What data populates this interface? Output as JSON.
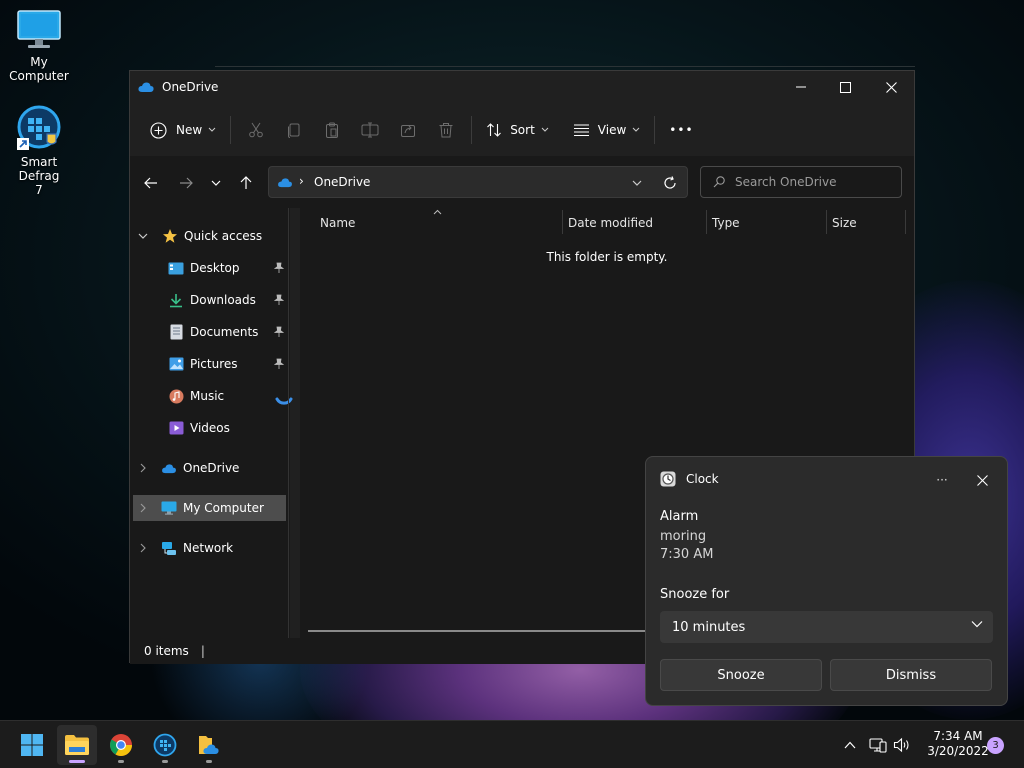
{
  "desktop": {
    "icons": [
      {
        "label": "My Computer"
      },
      {
        "label": "Smart Defrag\n7"
      }
    ]
  },
  "explorer": {
    "title": "OneDrive",
    "toolbar": {
      "new_label": "New",
      "sort_label": "Sort",
      "view_label": "View",
      "more_label": "•••"
    },
    "address": {
      "path_segment": "OneDrive",
      "separator": "›"
    },
    "search": {
      "placeholder": "Search OneDrive"
    },
    "nav": {
      "quick_access": "Quick access",
      "items": [
        {
          "label": "Desktop",
          "icon": "desktop-icon",
          "pinned": true
        },
        {
          "label": "Downloads",
          "icon": "download-icon",
          "pinned": true
        },
        {
          "label": "Documents",
          "icon": "document-icon",
          "pinned": true
        },
        {
          "label": "Pictures",
          "icon": "picture-icon",
          "pinned": true
        },
        {
          "label": "Music",
          "icon": "music-icon",
          "pinned": false
        },
        {
          "label": "Videos",
          "icon": "video-icon",
          "pinned": false
        }
      ],
      "onedrive": "OneDrive",
      "my_computer": "My Computer",
      "network": "Network"
    },
    "columns": [
      "Name",
      "Date modified",
      "Type",
      "Size"
    ],
    "empty_message": "This folder is empty.",
    "status": "0 items",
    "status_sep": "|"
  },
  "toast": {
    "app_name": "Clock",
    "more": "···",
    "heading": "Alarm",
    "alarm_name": "moring",
    "alarm_time": "7:30 AM",
    "snooze_label": "Snooze for",
    "snooze_value": "10 minutes",
    "snooze_button": "Snooze",
    "dismiss_button": "Dismiss"
  },
  "taskbar": {
    "time": "7:34 AM",
    "date": "3/20/2022",
    "notification_count": "3"
  },
  "colors": {
    "accent": "#4aa3f0",
    "selection": "#4d4d4d",
    "notification_badge": "#c9a3ff"
  }
}
